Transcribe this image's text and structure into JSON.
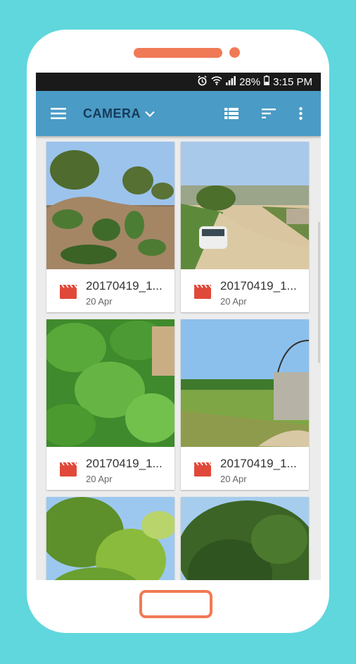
{
  "status": {
    "battery": "28%",
    "time": "3:15 PM"
  },
  "appbar": {
    "title": "CAMERA"
  },
  "items": [
    {
      "name": "20170419_1...",
      "date": "20 Apr"
    },
    {
      "name": "20170419_1...",
      "date": "20 Apr"
    },
    {
      "name": "20170419_1...",
      "date": "20 Apr"
    },
    {
      "name": "20170419_1...",
      "date": "20 Apr"
    },
    {
      "name": "",
      "date": ""
    },
    {
      "name": "",
      "date": ""
    }
  ],
  "colors": {
    "appbar": "#4a9bc5",
    "accent": "#f07a55",
    "background": "#5fd7dd",
    "video_icon": "#e0493a"
  }
}
